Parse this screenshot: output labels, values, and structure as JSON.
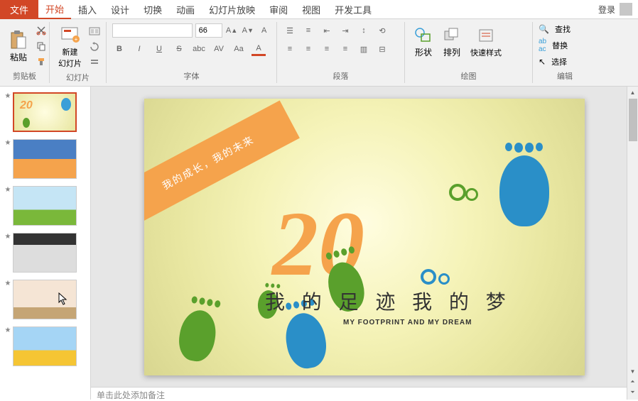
{
  "titlebar": {
    "file_tab": "文件",
    "tabs": [
      "开始",
      "插入",
      "设计",
      "切换",
      "动画",
      "幻灯片放映",
      "审阅",
      "视图",
      "开发工具"
    ],
    "active_tab_index": 0,
    "login_label": "登录"
  },
  "ribbon": {
    "clipboard": {
      "paste": "粘贴",
      "group_label": "剪贴板"
    },
    "slides": {
      "new_slide": "新建\n幻灯片",
      "group_label": "幻灯片"
    },
    "font": {
      "size": "66",
      "bold": "B",
      "italic": "I",
      "underline": "U",
      "strike": "S",
      "group_label": "字体"
    },
    "paragraph": {
      "group_label": "段落"
    },
    "drawing": {
      "shapes": "形状",
      "arrange": "排列",
      "quick_styles": "快速样式",
      "group_label": "绘图"
    },
    "editing": {
      "find": "查找",
      "replace": "替换",
      "select": "选择",
      "group_label": "编辑"
    }
  },
  "slide_content": {
    "banner_text": "我的成长，我的未来",
    "big_number": "20",
    "title": "我 的 足 迹  我 的 梦",
    "subtitle": "MY FOOTPRINT AND MY DREAM"
  },
  "notes": {
    "placeholder": "单击此处添加备注"
  },
  "thumbnails": {
    "count": 6,
    "active_index": 0
  }
}
